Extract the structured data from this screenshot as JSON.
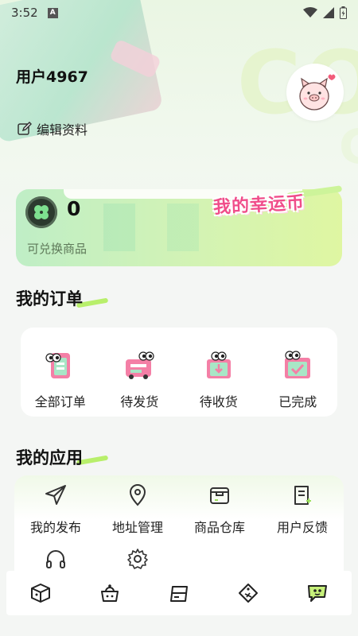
{
  "status_bar": {
    "time": "3:52",
    "notif_letter": "A"
  },
  "profile": {
    "username": "用户4967",
    "edit_label": "编辑资料"
  },
  "coins": {
    "count": "0",
    "subtitle": "可兑换商品",
    "title": "我的幸运币"
  },
  "orders": {
    "title": "我的订单",
    "items": [
      {
        "label": "全部订单",
        "icon": "all-orders-icon"
      },
      {
        "label": "待发货",
        "icon": "to-ship-icon"
      },
      {
        "label": "待收货",
        "icon": "to-receive-icon"
      },
      {
        "label": "已完成",
        "icon": "completed-icon"
      }
    ]
  },
  "apps": {
    "title": "我的应用",
    "items": [
      {
        "label": "我的发布",
        "icon": "send-icon"
      },
      {
        "label": "地址管理",
        "icon": "location-icon"
      },
      {
        "label": "商品仓库",
        "icon": "warehouse-icon"
      },
      {
        "label": "用户反馈",
        "icon": "feedback-icon"
      },
      {
        "label": "",
        "icon": "headphones-icon"
      },
      {
        "label": "",
        "icon": "gear-icon"
      }
    ]
  },
  "bottom_nav": [
    "box-icon",
    "pot-icon",
    "card-icon",
    "tag-icon",
    "chat-icon"
  ],
  "colors": {
    "accent_green": "#b8ef6b",
    "lucky_pink": "#f04d8a",
    "order_pink": "#f47fa6",
    "nav_active": "#c6f07a"
  }
}
